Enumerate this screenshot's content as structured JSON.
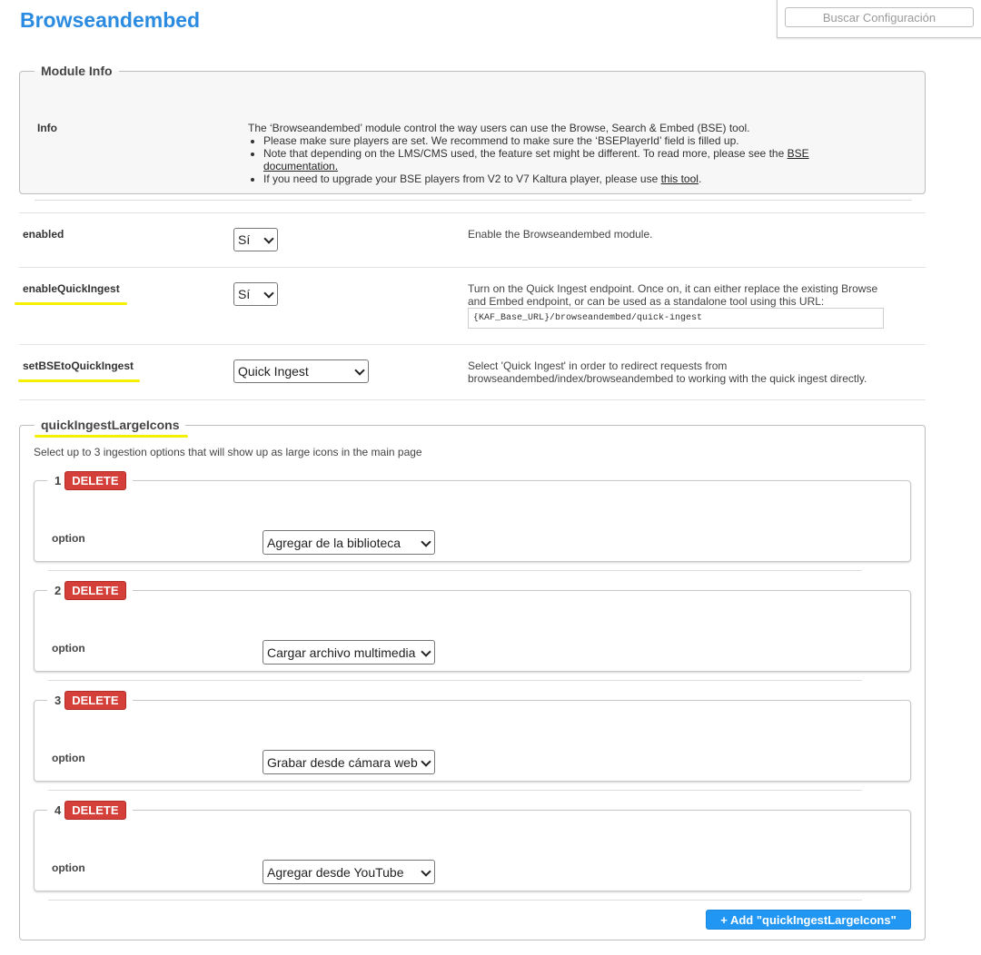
{
  "page": {
    "title": "Browseandembed",
    "search_placeholder": "Buscar Configuración"
  },
  "module_info": {
    "legend": "Module Info",
    "label": "Info",
    "intro": "The ‘Browseandembed’ module control the way users can use the Browse, Search & Embed (BSE) tool.",
    "bullet1": "Please make sure players are set. We recommend to make sure the ‘BSEPlayerId’ field is filled up.",
    "bullet2_text": "Note that depending on the LMS/CMS used, the feature set might be different. To read more, please see the ",
    "bullet2_link": "BSE documentation.",
    "bullet3_text": "If you need to upgrade your BSE players from V2 to V7 Kaltura player, please use ",
    "bullet3_link": "this tool",
    "bullet3_end": "."
  },
  "settings": {
    "enabled": {
      "label": "enabled",
      "value": "Sí",
      "description": "Enable the Browseandembed module."
    },
    "enableQuickIngest": {
      "label": "enableQuickIngest",
      "value": "Sí",
      "description": "Turn on the Quick Ingest endpoint. Once on, it can either replace the existing Browse and Embed endpoint, or can be used as a standalone tool using this URL:",
      "url": "{KAF_Base_URL}/browseandembed/quick-ingest"
    },
    "setBSEtoQuickIngest": {
      "label": "setBSEtoQuickIngest",
      "value": "Quick Ingest",
      "description": "Select 'Quick Ingest' in order to redirect requests from browseandembed/index/browseandembed to working with the quick ingest directly."
    }
  },
  "quick_ingest_large_icons": {
    "legend": "quickIngestLargeIcons",
    "help": "Select up to 3 ingestion options that will show up as large icons in the main page",
    "option_label": "option",
    "delete_label": "DELETE",
    "add_label": "+ Add \"quickIngestLargeIcons\"",
    "items": [
      {
        "number": "1",
        "value": "Agregar de la biblioteca"
      },
      {
        "number": "2",
        "value": "Cargar archivo multimedia"
      },
      {
        "number": "3",
        "value": "Grabar desde cámara web"
      },
      {
        "number": "4",
        "value": "Agregar desde YouTube"
      }
    ]
  },
  "colors": {
    "title": "#2a8be0",
    "delete_button": "#d43f3a",
    "add_button": "#2196f3",
    "highlight_marker": "#f5ef00"
  }
}
